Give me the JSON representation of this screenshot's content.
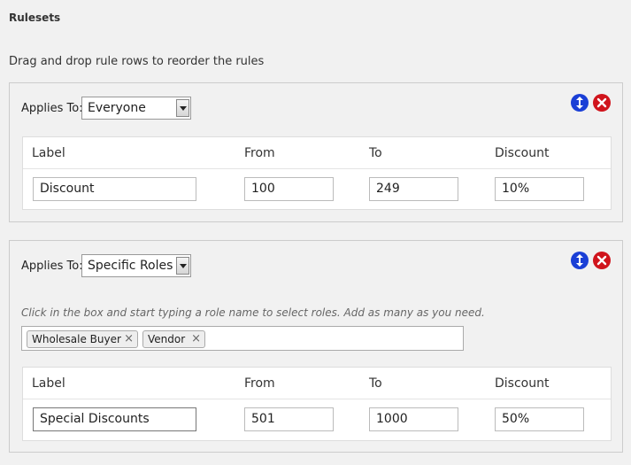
{
  "page": {
    "title": "Rulesets",
    "description": "Drag and drop rule rows to reorder the rules"
  },
  "rulesets": [
    {
      "applies_label": "Applies To:",
      "applies_value": "Everyone",
      "columns": [
        "Label",
        "From",
        "To",
        "Discount"
      ],
      "row": {
        "label": "Discount",
        "from": "100",
        "to": "249",
        "discount": "10%"
      }
    },
    {
      "applies_label": "Applies To:",
      "applies_value": "Specific Roles",
      "roles_hint": "Click in the box and start typing a role name to select roles. Add as many as you need.",
      "roles": [
        "Wholesale Buyer",
        "Vendor"
      ],
      "columns": [
        "Label",
        "From",
        "To",
        "Discount"
      ],
      "row": {
        "label": "Special Discounts",
        "from": "501",
        "to": "1000",
        "discount": "50%"
      }
    }
  ],
  "icons": {
    "move": "move-icon",
    "delete": "delete-icon",
    "remove_tag": "×"
  },
  "colors": {
    "move": "#1a3fd6",
    "delete": "#d0141c"
  }
}
